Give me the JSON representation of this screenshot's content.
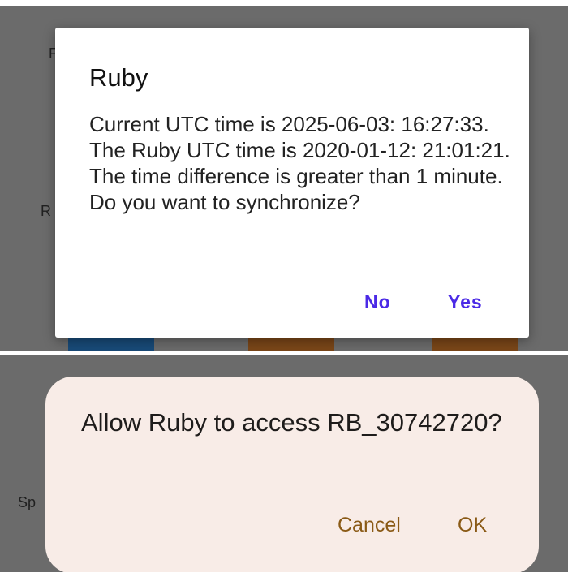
{
  "top_panel": {
    "background_labels": [
      "F",
      "R"
    ],
    "dialog": {
      "title": "Ruby",
      "message": "Current UTC time is 2025-06-03: 16:27:33. The Ruby UTC time is 2020-01-12: 21:01:21. The time difference is greater than 1 minute. Do you want to synchronize?",
      "no_label": "No",
      "yes_label": "Yes"
    }
  },
  "bottom_panel": {
    "background_labels": [
      "Sp"
    ],
    "dialog": {
      "message": "Allow Ruby to access RB_30742720?",
      "cancel_label": "Cancel",
      "ok_label": "OK"
    }
  },
  "colors": {
    "scrim": "#6b6b6b",
    "dialog_button_blue": "#4b2ae6",
    "access_dialog_background": "#f8ece7",
    "access_button_brown": "#8a5a16",
    "tile_blue": "#184a78",
    "tile_orange": "#7a4618"
  }
}
